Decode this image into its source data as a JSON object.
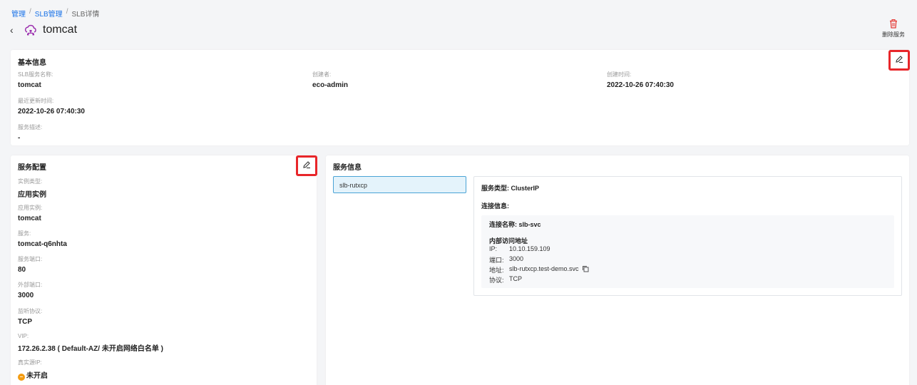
{
  "breadcrumb": {
    "item1": "管理",
    "item2": "SLB管理",
    "item3": "SLB详情",
    "sep": "/"
  },
  "header": {
    "back": "‹",
    "title": "tomcat",
    "delete_label": "删除服务"
  },
  "basic_info": {
    "title": "基本信息",
    "fields": [
      {
        "label": "SLB服务名称:",
        "value": "tomcat"
      },
      {
        "label": "创建者:",
        "value": "eco-admin"
      },
      {
        "label": "创建时间:",
        "value": "2022-10-26 07:40:30"
      },
      {
        "label": "最近更新时间:",
        "value": "2022-10-26 07:40:30"
      },
      {
        "label": "服务描述:",
        "value": "-"
      }
    ]
  },
  "service_config": {
    "title": "服务配置",
    "fields": [
      {
        "label": "实例类型:",
        "value": "应用实例"
      },
      {
        "label": "应用实例:",
        "value": "tomcat"
      },
      {
        "label": "服务:",
        "value": "tomcat-q6nhta"
      },
      {
        "label": "服务端口:",
        "value": "80"
      },
      {
        "label": "外部端口:",
        "value": "3000"
      },
      {
        "label": "监听协议:",
        "value": "TCP"
      },
      {
        "label": "VIP:",
        "value": "172.26.2.38 ( Default-AZ/ 未开启网络白名单 )"
      },
      {
        "label": "真实源IP:",
        "value": "未开启",
        "status_mark": "–"
      }
    ]
  },
  "service_info": {
    "title": "服务信息",
    "tab": "slb-rutxcp",
    "service_type": "服务类型: ClusterIP",
    "connection_title": "连接信息:",
    "connection_name": "连接名称: slb-svc",
    "internal_title": "内部访问地址",
    "rows": [
      {
        "key": "IP:",
        "value": "10.10.159.109"
      },
      {
        "key": "端口:",
        "value": "3000"
      },
      {
        "key": "地址:",
        "value": "slb-rutxcp.test-demo.svc"
      },
      {
        "key": "协议:",
        "value": "TCP"
      }
    ]
  },
  "colors": {
    "accent": "#1a73e8",
    "highlight": "#e8262a",
    "icon_purple": "#9b2fae",
    "warning": "#f39c12",
    "tab_border": "#4aa3d6"
  },
  "icons": {
    "title": "cloud-network-icon",
    "delete": "trash-icon",
    "edit": "pencil-icon",
    "copy": "copy-icon",
    "status": "minus-circle-icon"
  }
}
